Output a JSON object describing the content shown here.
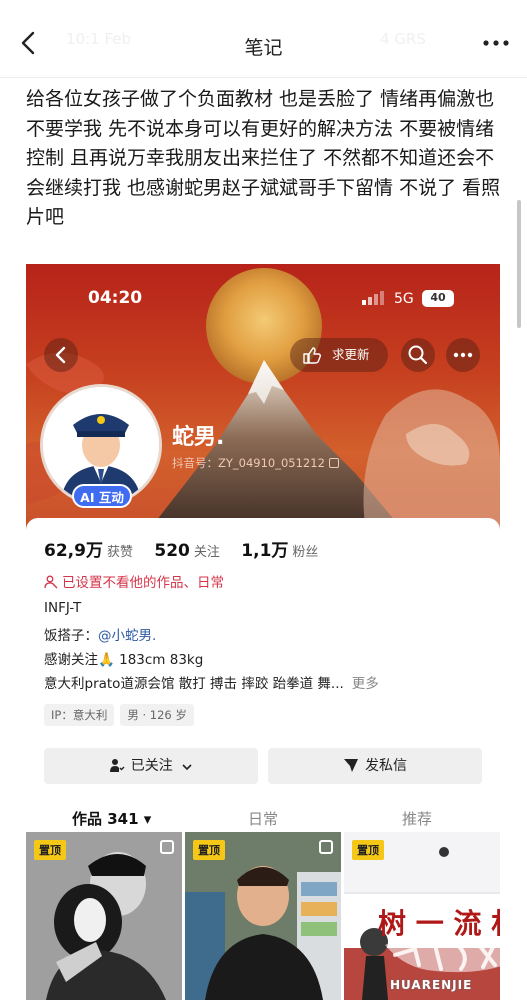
{
  "app": {
    "title": "笔记",
    "ghost_left": "10:1 Feb",
    "ghost_right": "4 GRS"
  },
  "post": {
    "text": "给各位女孩子做了个负面教材 也是丢脸了 情绪再偏激也不要学我 先不说本身可以有更好的解决方法 不要被情绪控制 且再说万幸我朋友出来拦住了 不然都不知道还会不会继续打我 也感谢蛇男赵子斌斌哥手下留情  不说了 看照片吧"
  },
  "screenshot": {
    "status": {
      "time": "04:20",
      "network": "5G",
      "battery": "40"
    },
    "request_update_label": "求更新",
    "profile": {
      "nickname": "蛇男.",
      "douyin_id": "抖音号：ZY_04910_051212",
      "ai_badge": "AI 互动",
      "stats": [
        {
          "value": "62,9万",
          "label": "获赞"
        },
        {
          "value": "520",
          "label": "关注"
        },
        {
          "value": "1,1万",
          "label": "粉丝"
        }
      ],
      "blocked_notice": "已设置不看他的作品、日常",
      "bio_line1": "INFJ-T",
      "bio_line2_prefix": "饭搭子：",
      "bio_line2_mention": "@小蛇男.",
      "bio_line3": "感谢关注🙏   183cm 83kg",
      "bio_line4": "意大利prato道源会馆 散打 搏击 摔跤 跆拳道 舞...",
      "bio_more": "更多",
      "tags": [
        "IP：意大利",
        "男 · 126 岁"
      ]
    },
    "buttons": {
      "follow": "已关注",
      "message": "发私信"
    },
    "tabs": [
      {
        "label": "作品 341 ▾",
        "active": true
      },
      {
        "label": "日常",
        "active": false
      },
      {
        "label": "推荐",
        "active": false
      }
    ],
    "thumbnails": [
      {
        "badge": "置顶"
      },
      {
        "badge": "置顶"
      },
      {
        "badge": "置顶",
        "sign_text": "树 一 流 村"
      }
    ]
  },
  "watermark": {
    "text": "HUARENJIE"
  },
  "colors": {
    "hero_red": "#b7231a",
    "blocked_red": "#d6344a",
    "mention_blue": "#2c5aa0",
    "ai_blue": "#3f6cf0",
    "pin_yellow": "#f5c817"
  }
}
